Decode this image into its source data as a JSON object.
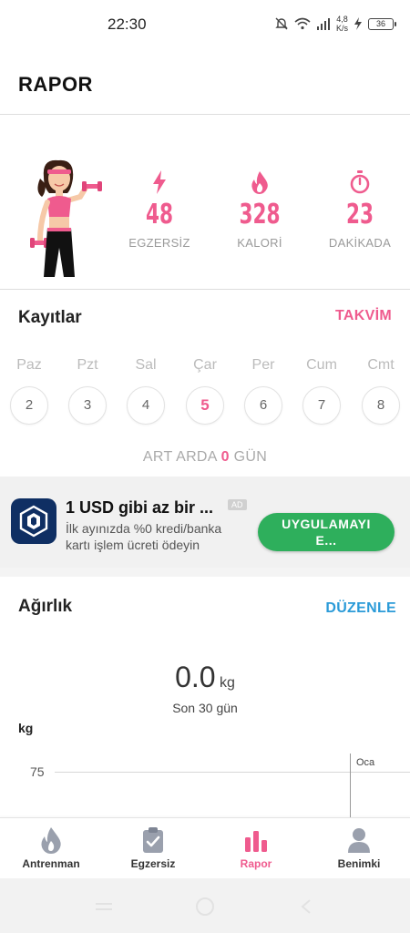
{
  "status_bar": {
    "time": "22:30",
    "speed_value": "4,8",
    "speed_unit": "K/s",
    "battery": "36",
    "icons": [
      "bell-off-icon",
      "wifi-icon",
      "signal-icon",
      "charging-icon",
      "battery-icon"
    ]
  },
  "header": {
    "title": "RAPOR"
  },
  "stats": [
    {
      "value": "48",
      "label": "EGZERSİZ",
      "icon": "bolt-icon"
    },
    {
      "value": "328",
      "label": "KALORİ",
      "icon": "flame-icon"
    },
    {
      "value": "23",
      "label": "DAKİKADA",
      "icon": "stopwatch-icon"
    }
  ],
  "records": {
    "title": "Kayıtlar",
    "calendar_label": "TAKVİM",
    "days": [
      {
        "name": "Paz",
        "date": "2"
      },
      {
        "name": "Pzt",
        "date": "3"
      },
      {
        "name": "Sal",
        "date": "4"
      },
      {
        "name": "Çar",
        "date": "5"
      },
      {
        "name": "Per",
        "date": "6"
      },
      {
        "name": "Cum",
        "date": "7"
      },
      {
        "name": "Cmt",
        "date": "8"
      }
    ],
    "today_index": 3,
    "streak_prefix": "ART ARDA",
    "streak_count": "0",
    "streak_suffix": "GÜN"
  },
  "ad": {
    "headline": "1 USD gibi az bir ...",
    "badge": "AD",
    "description": "İlk ayınızda %0 kredi/banka kartı işlem ücreti ödeyin",
    "cta_line1": "UYGULAMAYI",
    "cta_line2": "E..."
  },
  "weight": {
    "title": "Ağırlık",
    "edit_label": "DÜZENLE",
    "value": "0.0",
    "unit": "kg",
    "period": "Son 30 gün",
    "y_unit": "kg",
    "y_tick": "75",
    "x_label": "Oca"
  },
  "bottom_nav": [
    {
      "label": "Antrenman",
      "icon": "fire-icon"
    },
    {
      "label": "Egzersiz",
      "icon": "clipboard-icon"
    },
    {
      "label": "Rapor",
      "icon": "bar-chart-icon"
    },
    {
      "label": "Benimki",
      "icon": "person-icon"
    }
  ],
  "active_nav_index": 2,
  "colors": {
    "accent": "#ef5b8e",
    "link": "#2b9bd8",
    "cta": "#2eaf5c"
  }
}
